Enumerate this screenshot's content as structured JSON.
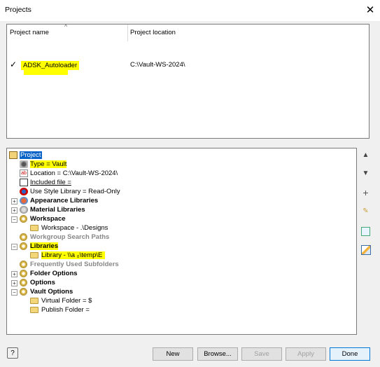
{
  "window": {
    "title": "Projects"
  },
  "projects_list": {
    "columns": {
      "name": "Project name",
      "location": "Project location"
    },
    "rows": [
      {
        "checked": "✓",
        "name": "ADSK_Autoloader",
        "location": "C:\\Vault-WS-2024\\"
      }
    ]
  },
  "tree": {
    "root": "Project",
    "type": "Type = Vault",
    "location": "Location = C:\\Vault-WS-2024\\",
    "included_file": "Included file =",
    "use_style_library": "Use Style Library = Read-Only",
    "appearance_libraries": "Appearance Libraries",
    "material_libraries": "Material Libraries",
    "workspace": "Workspace",
    "workspace_value": "Workspace - .\\Designs",
    "workgroup_search_paths": "Workgroup Search Paths",
    "libraries": "Libraries",
    "library_value": "Library - \\\\a          ₀\\temp\\E",
    "frequently_used_subfolders": "Frequently Used Subfolders",
    "folder_options": "Folder Options",
    "options": "Options",
    "vault_options": "Vault Options",
    "virtual_folder": "Virtual Folder = $",
    "publish_folder": "Publish Folder ="
  },
  "buttons": {
    "new": "New",
    "browse": "Browse...",
    "save": "Save",
    "apply": "Apply",
    "done": "Done",
    "help": "?"
  },
  "side_buttons": [
    "move-up",
    "move-down",
    "add",
    "edit",
    "find",
    "edit-settings"
  ]
}
